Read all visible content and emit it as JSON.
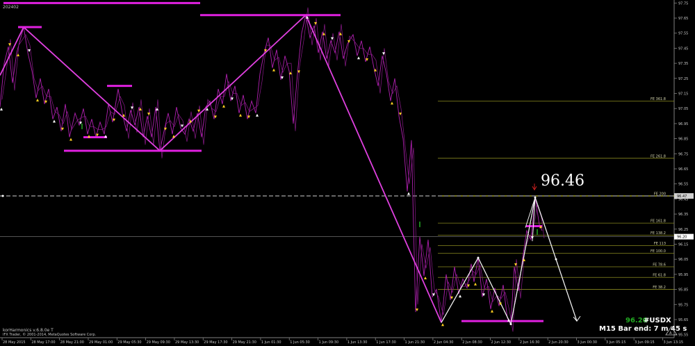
{
  "window": {
    "id_label": "202402"
  },
  "footer": {
    "indicator": "korHarmonics v.6.8.0e T",
    "copyright": "IFX Trader, © 2001-2014, MetaQuotes Software Corp."
  },
  "overlay": {
    "callout_price": "96.46",
    "current_price": "96.20",
    "symbol": "#USDX",
    "bar_timer": "M15 Bar end: 7 m 45 s"
  },
  "chart_data": {
    "type": "line",
    "ylim": [
      95.53,
      97.77
    ],
    "y_ticks": [
      "97.75",
      "97.65",
      "97.55",
      "97.45",
      "97.35",
      "97.25",
      "97.15",
      "97.05",
      "96.95",
      "96.85",
      "96.75",
      "96.65",
      "96.55",
      "96.45",
      "96.35",
      "96.25",
      "96.15",
      "96.05",
      "95.95",
      "95.85",
      "95.75",
      "95.65",
      "95.55"
    ],
    "x_tick_labels": [
      "28 May 2015",
      "28 May 17:00",
      "28 May 21:00",
      "29 May 01:00",
      "29 May 05:30",
      "29 May 09:30",
      "29 May 13:30",
      "29 May 17:30",
      "29 May 21:30",
      "1 Jun 01:30",
      "1 Jun 05:30",
      "1 Jun 09:30",
      "1 Jun 13:30",
      "1 Jun 17:30",
      "1 Jun 21:30",
      "2 Jun 04:30",
      "2 Jun 08:30",
      "2 Jun 12:30",
      "2 Jun 16:30",
      "2 Jun 20:30",
      "3 Jun 00:30",
      "3 Jun 05:15",
      "3 Jun 09:15",
      "3 Jun 13:15"
    ],
    "price_line_labels": {
      "upper": "96.47",
      "current": "96.20"
    },
    "fe_levels": [
      {
        "label": "FE 361.8",
        "value": 97.1
      },
      {
        "label": "FE 261.8",
        "value": 96.72
      },
      {
        "label": "FE 200",
        "value": 96.47
      },
      {
        "label": "FE 161.8",
        "value": 96.29
      },
      {
        "label": "FE 138.2",
        "value": 96.21
      },
      {
        "label": "FE 113",
        "value": 96.14
      },
      {
        "label": "FE 100.0",
        "value": 96.09
      },
      {
        "label": "FE 78.6",
        "value": 96.0
      },
      {
        "label": "FE 61.8",
        "value": 95.93
      },
      {
        "label": "FE 38.2",
        "value": 95.85
      }
    ],
    "zigzag_major": [
      {
        "i": 0,
        "y": 97.27
      },
      {
        "i": 34,
        "y": 97.59
      },
      {
        "i": 230,
        "y": 96.77
      },
      {
        "i": 440,
        "y": 97.67
      },
      {
        "i": 635,
        "y": 95.63
      },
      {
        "i": 688,
        "y": 96.06
      },
      {
        "i": 735,
        "y": 95.62
      },
      {
        "i": 770,
        "y": 96.46
      },
      {
        "i": 830,
        "y": 95.64
      }
    ],
    "minor_path": [
      [
        0,
        97.06
      ],
      [
        6,
        97.35
      ],
      [
        12,
        97.46
      ],
      [
        18,
        97.22
      ],
      [
        24,
        97.42
      ],
      [
        34,
        97.59
      ],
      [
        40,
        97.42
      ],
      [
        46,
        97.3
      ],
      [
        52,
        97.12
      ],
      [
        58,
        97.25
      ],
      [
        64,
        97.08
      ],
      [
        70,
        97.18
      ],
      [
        76,
        96.98
      ],
      [
        82,
        97.06
      ],
      [
        88,
        96.9
      ],
      [
        94,
        97.08
      ],
      [
        100,
        96.86
      ],
      [
        108,
        97.02
      ],
      [
        114,
        96.94
      ],
      [
        120,
        97.05
      ],
      [
        126,
        96.88
      ],
      [
        132,
        96.98
      ],
      [
        138,
        96.86
      ],
      [
        144,
        96.96
      ],
      [
        150,
        96.88
      ],
      [
        156,
        97.08
      ],
      [
        162,
        96.96
      ],
      [
        170,
        97.18
      ],
      [
        176,
        97.02
      ],
      [
        182,
        96.9
      ],
      [
        188,
        97.04
      ],
      [
        194,
        96.94
      ],
      [
        200,
        97.06
      ],
      [
        206,
        96.86
      ],
      [
        212,
        97.0
      ],
      [
        218,
        96.86
      ],
      [
        224,
        97.06
      ],
      [
        230,
        96.77
      ],
      [
        236,
        96.9
      ],
      [
        242,
        97.02
      ],
      [
        248,
        96.88
      ],
      [
        254,
        97.06
      ],
      [
        260,
        96.92
      ],
      [
        266,
        96.88
      ],
      [
        272,
        96.98
      ],
      [
        278,
        96.9
      ],
      [
        284,
        97.02
      ],
      [
        290,
        96.86
      ],
      [
        296,
        97.06
      ],
      [
        302,
        97.1
      ],
      [
        308,
        96.98
      ],
      [
        314,
        97.18
      ],
      [
        320,
        97.08
      ],
      [
        326,
        97.28
      ],
      [
        332,
        97.1
      ],
      [
        338,
        97.2
      ],
      [
        344,
        97.02
      ],
      [
        350,
        97.14
      ],
      [
        356,
        96.98
      ],
      [
        362,
        97.1
      ],
      [
        368,
        97.02
      ],
      [
        374,
        97.28
      ],
      [
        380,
        97.42
      ],
      [
        386,
        97.52
      ],
      [
        392,
        97.32
      ],
      [
        398,
        97.44
      ],
      [
        404,
        97.24
      ],
      [
        410,
        97.4
      ],
      [
        416,
        97.3
      ],
      [
        422,
        96.95
      ],
      [
        428,
        97.28
      ],
      [
        434,
        97.55
      ],
      [
        440,
        97.67
      ],
      [
        446,
        97.52
      ],
      [
        452,
        97.6
      ],
      [
        458,
        97.42
      ],
      [
        464,
        97.56
      ],
      [
        470,
        97.38
      ],
      [
        476,
        97.5
      ],
      [
        482,
        97.42
      ],
      [
        488,
        97.56
      ],
      [
        494,
        97.38
      ],
      [
        500,
        97.48
      ],
      [
        508,
        97.54
      ],
      [
        514,
        97.4
      ],
      [
        520,
        97.5
      ],
      [
        526,
        97.36
      ],
      [
        532,
        97.46
      ],
      [
        538,
        97.32
      ],
      [
        544,
        97.2
      ],
      [
        550,
        97.4
      ],
      [
        556,
        97.28
      ],
      [
        562,
        97.1
      ],
      [
        568,
        97.25
      ],
      [
        574,
        97.0
      ],
      [
        580,
        96.85
      ],
      [
        586,
        96.5
      ],
      [
        592,
        96.84
      ],
      [
        598,
        95.7
      ],
      [
        604,
        96.2
      ],
      [
        610,
        95.94
      ],
      [
        616,
        96.18
      ],
      [
        622,
        95.8
      ],
      [
        628,
        95.85
      ],
      [
        635,
        95.63
      ],
      [
        642,
        95.95
      ],
      [
        648,
        95.78
      ],
      [
        654,
        96.0
      ],
      [
        660,
        95.82
      ],
      [
        666,
        95.92
      ],
      [
        672,
        95.86
      ],
      [
        678,
        96.02
      ],
      [
        682,
        95.9
      ],
      [
        688,
        96.06
      ],
      [
        694,
        95.8
      ],
      [
        700,
        95.92
      ],
      [
        706,
        95.72
      ],
      [
        712,
        95.86
      ],
      [
        718,
        95.74
      ],
      [
        724,
        95.88
      ],
      [
        730,
        95.66
      ],
      [
        735,
        95.62
      ],
      [
        740,
        96.0
      ],
      [
        746,
        95.84
      ],
      [
        752,
        96.06
      ],
      [
        758,
        96.24
      ],
      [
        764,
        96.18
      ],
      [
        770,
        96.46
      ],
      [
        776,
        96.28
      ],
      [
        780,
        96.24
      ]
    ]
  }
}
